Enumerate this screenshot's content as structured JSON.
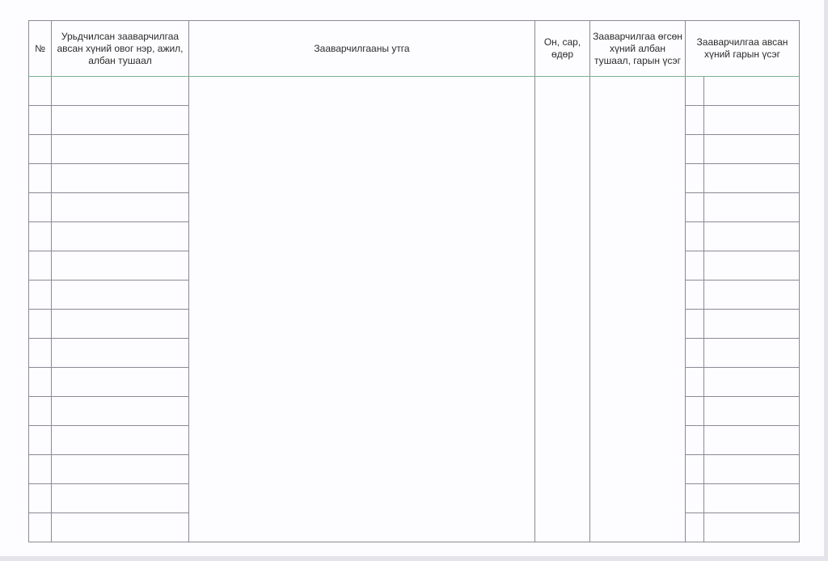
{
  "form": {
    "headers": {
      "number": "№",
      "instructed_person": "Урьдчилсан заавarчилгаа авсан хүний овог нэр, ажил, албан тушаал",
      "instruction_content": "Зааварчилгааны утга",
      "date": "Он, сар, өдөр",
      "instructor": "Зааварчилгаа өгсөн хүний албан тушаал, гарын үсэг",
      "signature": "Зааварчилгаа авсан хүний гарын үсэг"
    },
    "row_count": 16
  }
}
